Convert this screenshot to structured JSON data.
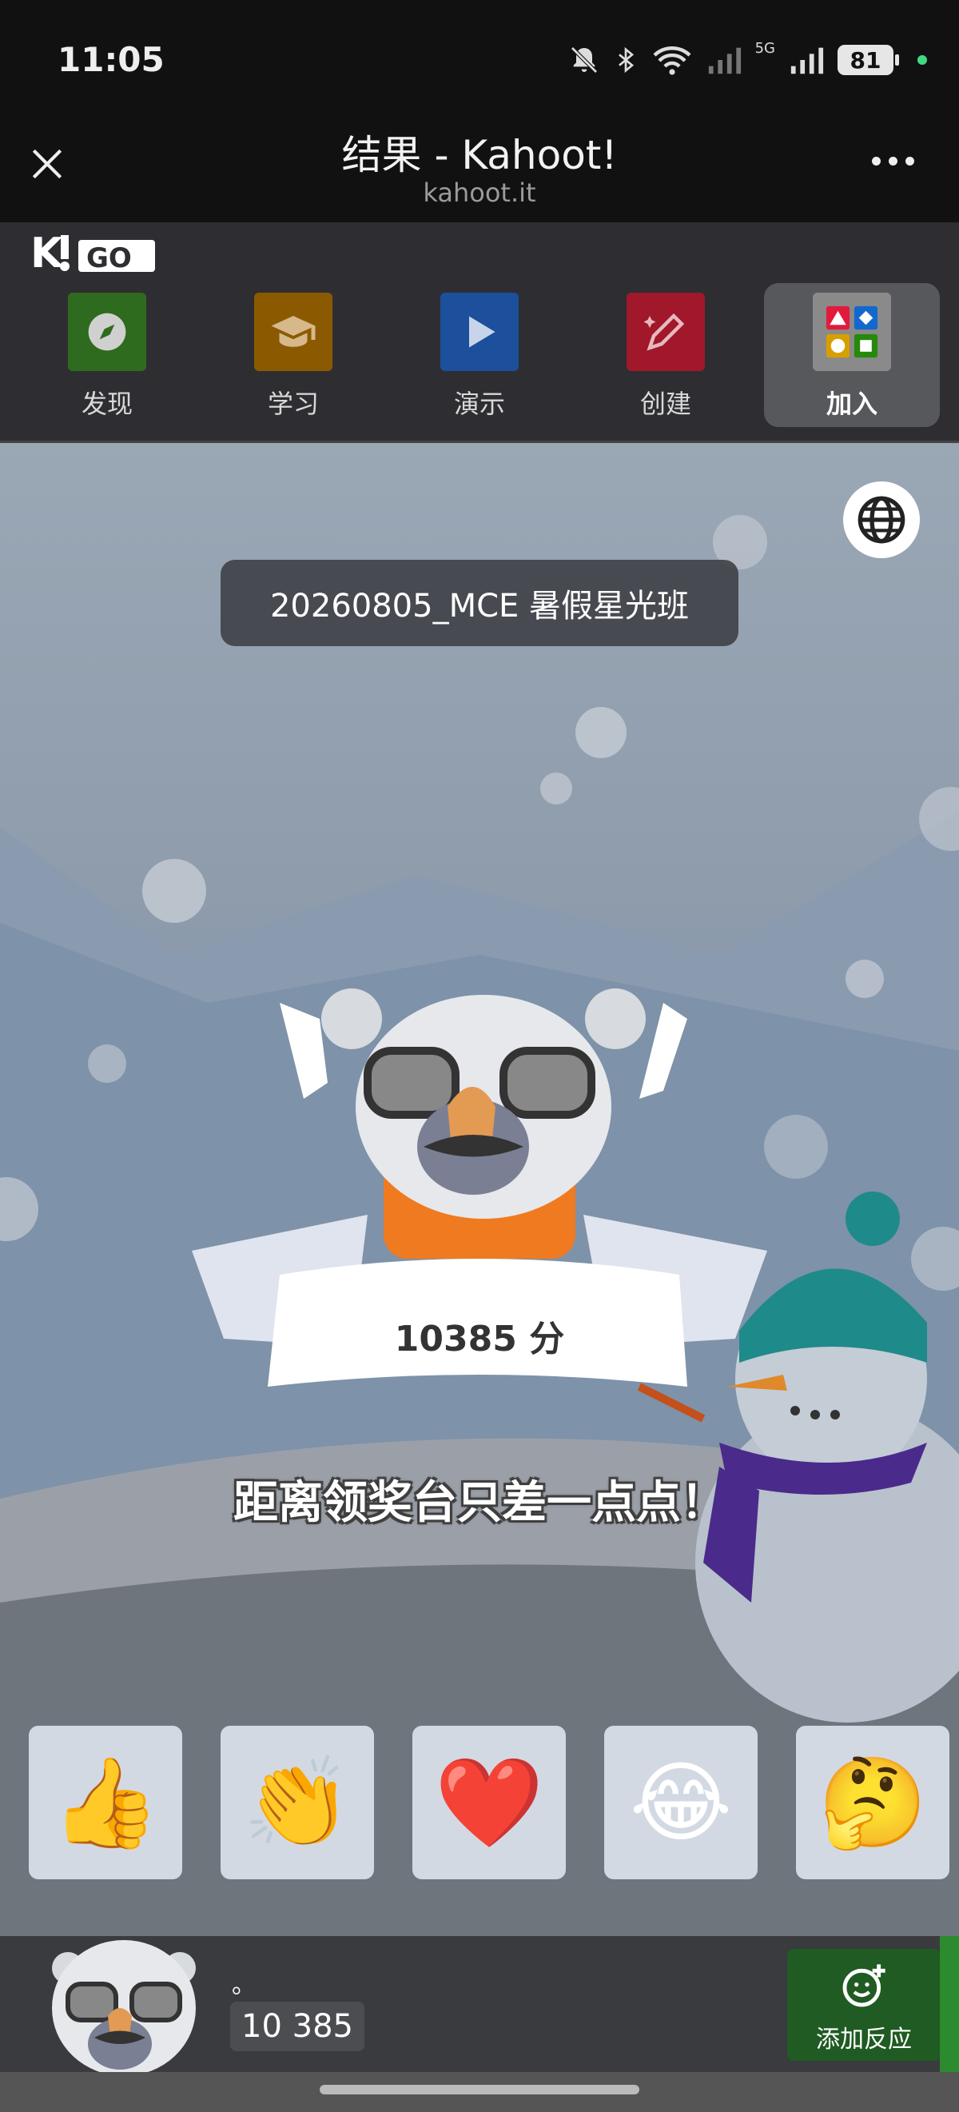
{
  "status_bar": {
    "time": "11:05",
    "network_label": "5G",
    "battery": "81"
  },
  "browser": {
    "title": "结果 - Kahoot!",
    "url": "kahoot.it"
  },
  "app_nav": {
    "logo_icon": "kahoot-go-logo",
    "items": [
      {
        "label": "发现",
        "icon": "compass-icon",
        "color": "#2e6b1e"
      },
      {
        "label": "学习",
        "icon": "graduation-cap-icon",
        "color": "#8b5a00"
      },
      {
        "label": "演示",
        "icon": "play-icon",
        "color": "#1c4f9c"
      },
      {
        "label": "创建",
        "icon": "magic-pencil-icon",
        "color": "#a0182a"
      },
      {
        "label": "加入",
        "icon": "shapes-grid-icon",
        "color": "#8a8a8a",
        "active": true
      }
    ]
  },
  "game": {
    "name": "20260805_MCE 暑假星光班",
    "score_text": "10385 分",
    "message": "距离领奖台只差一点点！"
  },
  "reactions": [
    {
      "emoji": "👍",
      "name": "thumbs-up"
    },
    {
      "emoji": "👏",
      "name": "clapping"
    },
    {
      "emoji": "❤️",
      "name": "heart"
    },
    {
      "emoji": "😂",
      "name": "laughing"
    },
    {
      "emoji": "🤔",
      "name": "thinking"
    }
  ],
  "player": {
    "nickname": "。",
    "score": "10 385",
    "add_reaction_label": "添加反应"
  },
  "colors": {
    "accent_green": "#1f5b22",
    "scene_sky": "#8e9cac"
  }
}
